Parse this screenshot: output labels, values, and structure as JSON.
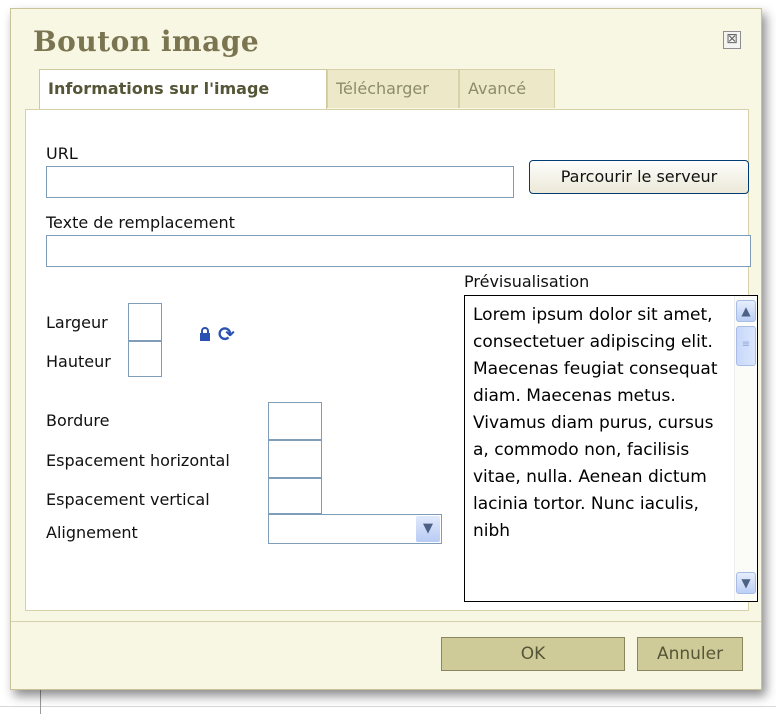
{
  "dialog": {
    "title": "Bouton image",
    "close_glyph": "⊠"
  },
  "tabs": [
    {
      "label": "Informations sur l'image",
      "active": true
    },
    {
      "label": "Télécharger",
      "active": false
    },
    {
      "label": "Avancé",
      "active": false
    }
  ],
  "form": {
    "url_label": "URL",
    "url_value": "",
    "browse_label": "Parcourir le serveur",
    "alt_label": "Texte de remplacement",
    "alt_value": "",
    "width_label": "Largeur",
    "height_label": "Hauteur",
    "border_label": "Bordure",
    "hspace_label": "Espacement horizontal",
    "vspace_label": "Espacement vertical",
    "align_label": "Alignement",
    "align_value": ""
  },
  "preview": {
    "label": "Prévisualisation",
    "text": "Lorem ipsum dolor sit amet, consectetuer adipiscing elit. Maecenas feugiat consequat diam. Maecenas metus. Vivamus diam purus, cursus a, commodo non, facilisis vitae, nulla. Aenean dictum lacinia tortor. Nunc iaculis, nibh"
  },
  "footer": {
    "ok_label": "OK",
    "cancel_label": "Annuler"
  },
  "colors": {
    "dialog_bg": "#f7f7e3",
    "title": "#7a7450",
    "button_bg": "#cfcb98"
  }
}
